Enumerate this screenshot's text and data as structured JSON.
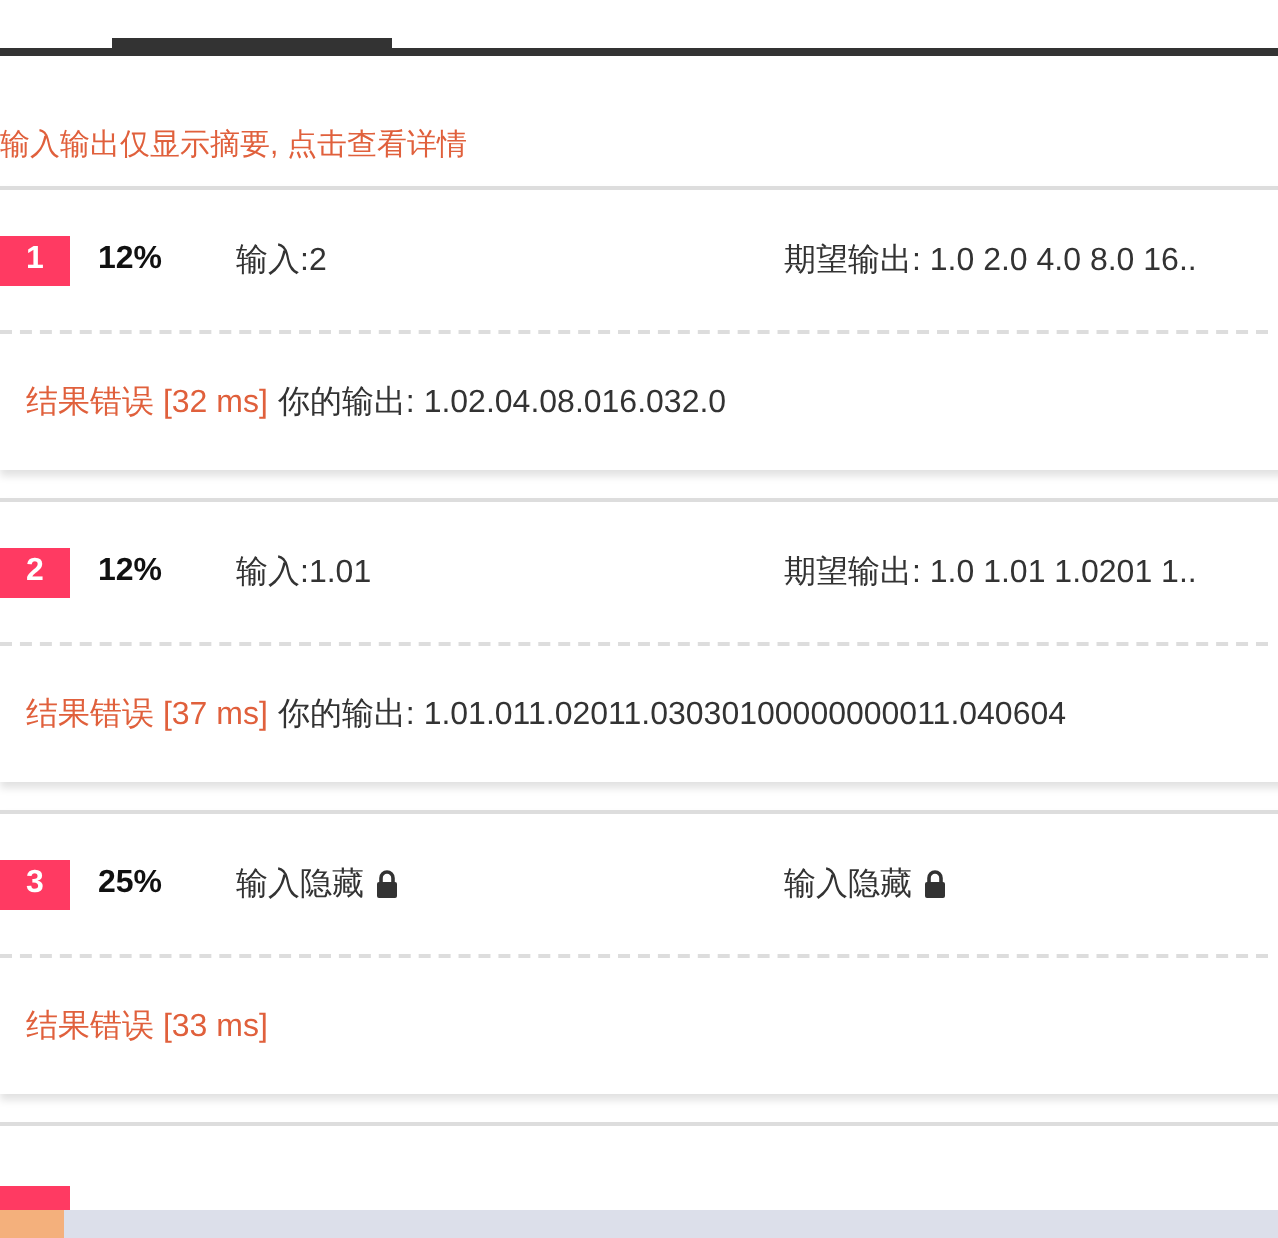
{
  "notice": "输入输出仅显示摘要, 点击查看详情",
  "cases": [
    {
      "number": "1",
      "score": "12%",
      "input": {
        "kind": "text",
        "text": "输入:2"
      },
      "expected": {
        "kind": "text",
        "text": "期望输出: 1.0 2.0 4.0 8.0 16.."
      },
      "status": "结果错误",
      "time": "[32 ms]",
      "output": "你的输出: 1.02.04.08.016.032.0"
    },
    {
      "number": "2",
      "score": "12%",
      "input": {
        "kind": "text",
        "text": "输入:1.01"
      },
      "expected": {
        "kind": "text",
        "text": "期望输出: 1.0 1.01 1.0201 1.."
      },
      "status": "结果错误",
      "time": "[37 ms]",
      "output": "你的输出: 1.01.011.02011.03030100000000011.040604"
    },
    {
      "number": "3",
      "score": "25%",
      "input": {
        "kind": "hidden",
        "text": "输入隐藏"
      },
      "expected": {
        "kind": "hidden",
        "text": "输入隐藏"
      },
      "status": "结果错误",
      "time": "[33 ms]"
    }
  ]
}
